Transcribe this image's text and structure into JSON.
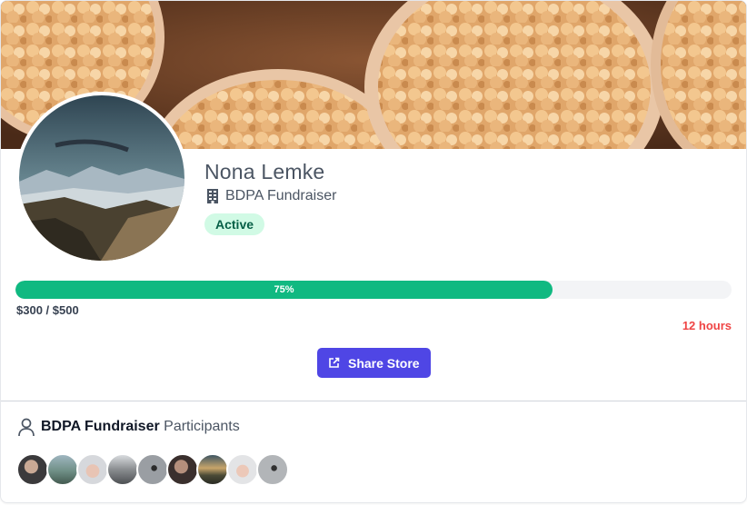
{
  "profile": {
    "name": "Nona Lemke",
    "organization": "BDPA Fundraiser",
    "status": "Active",
    "organization_icon": "building-icon"
  },
  "progress": {
    "percent": 75,
    "percent_label": "75%",
    "amount_label": "$300 / $500",
    "time_left": "12 hours"
  },
  "actions": {
    "share_label": "Share Store",
    "share_icon": "external-link-icon"
  },
  "participants": {
    "group_name": "BDPA Fundraiser",
    "suffix": "Participants",
    "icon": "user-icon",
    "avatars": [
      {
        "name": "participant-avatar"
      },
      {
        "name": "participant-avatar"
      },
      {
        "name": "participant-avatar"
      },
      {
        "name": "participant-avatar"
      },
      {
        "name": "participant-avatar"
      },
      {
        "name": "participant-avatar"
      },
      {
        "name": "participant-avatar"
      },
      {
        "name": "participant-avatar"
      },
      {
        "name": "participant-avatar"
      }
    ]
  },
  "colors": {
    "accent": "#4f46e5",
    "progress": "#10b981",
    "badge_bg": "#d1fae5",
    "badge_text": "#065f46",
    "time_left": "#ef4444"
  }
}
